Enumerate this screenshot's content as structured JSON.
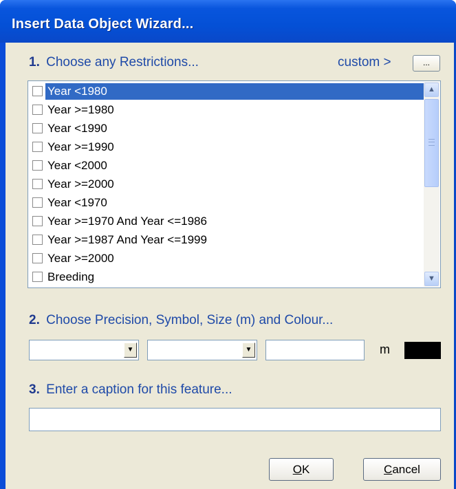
{
  "window": {
    "title": "Insert Data Object Wizard..."
  },
  "step1": {
    "number": "1.",
    "label": "Choose any Restrictions...",
    "custom_label": "custom >",
    "custom_button": "..."
  },
  "restrictions": [
    {
      "label": "Year <1980",
      "checked": false,
      "selected": true
    },
    {
      "label": "Year >=1980",
      "checked": false,
      "selected": false
    },
    {
      "label": "Year <1990",
      "checked": false,
      "selected": false
    },
    {
      "label": "Year >=1990",
      "checked": false,
      "selected": false
    },
    {
      "label": "Year <2000",
      "checked": false,
      "selected": false
    },
    {
      "label": "Year >=2000",
      "checked": false,
      "selected": false
    },
    {
      "label": "Year <1970",
      "checked": false,
      "selected": false
    },
    {
      "label": "Year >=1970 And Year <=1986",
      "checked": false,
      "selected": false
    },
    {
      "label": "Year >=1987 And Year <=1999",
      "checked": false,
      "selected": false
    },
    {
      "label": "Year >=2000",
      "checked": false,
      "selected": false
    },
    {
      "label": "Breeding",
      "checked": false,
      "selected": false
    }
  ],
  "step2": {
    "number": "2.",
    "label": "Choose Precision, Symbol, Size (m) and Colour...",
    "precision_value": "",
    "symbol_value": "",
    "size_value": "",
    "size_unit": "m",
    "colour": "#000000"
  },
  "step3": {
    "number": "3.",
    "label": "Enter a caption for this feature...",
    "caption_value": ""
  },
  "buttons": {
    "ok_mnemonic": "O",
    "ok_rest": "K",
    "cancel_mnemonic": "C",
    "cancel_rest": "ancel"
  },
  "icons": {
    "scroll_up": "scroll-up-arrow-icon",
    "scroll_down": "scroll-down-arrow-icon",
    "dropdown": "chevron-down-icon"
  }
}
